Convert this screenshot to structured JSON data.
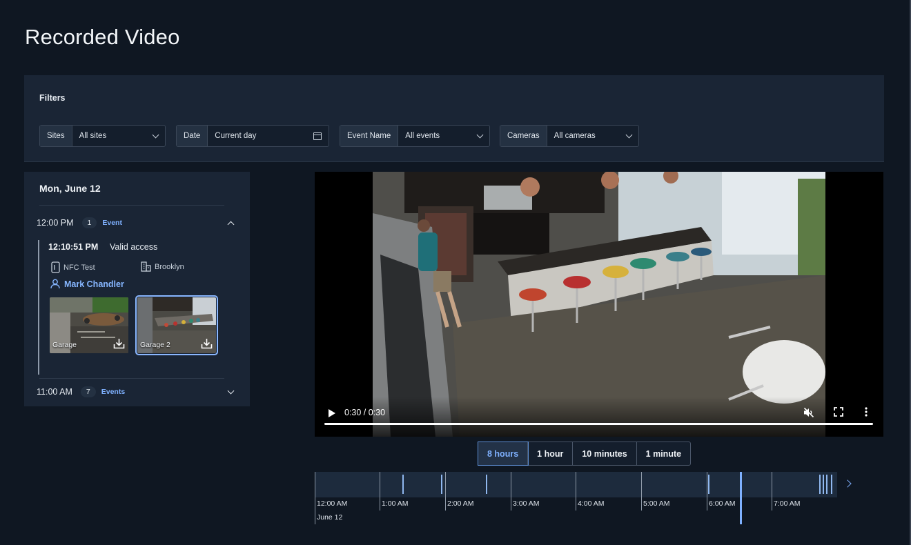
{
  "page": {
    "title": "Recorded Video"
  },
  "filters": {
    "title": "Filters",
    "sites": {
      "label": "Sites",
      "value": "All sites"
    },
    "date": {
      "label": "Date",
      "value": "Current day"
    },
    "event_name": {
      "label": "Event Name",
      "value": "All events"
    },
    "cameras": {
      "label": "Cameras",
      "value": "All cameras"
    }
  },
  "events_panel": {
    "day": "Mon, June 12",
    "groups": [
      {
        "time": "12:00 PM",
        "count": "1",
        "unit": "Event",
        "expanded": true
      },
      {
        "time": "11:00 AM",
        "count": "7",
        "unit": "Events",
        "expanded": false
      }
    ],
    "event": {
      "time": "12:10:51 PM",
      "name": "Valid access",
      "device": "NFC Test",
      "site": "Brooklyn",
      "person": "Mark Chandler",
      "cameras": [
        {
          "name": "Garage",
          "selected": false
        },
        {
          "name": "Garage 2",
          "selected": true
        }
      ]
    }
  },
  "player": {
    "time": "0:30 / 0:30",
    "progress": 1.0,
    "muted": true
  },
  "zoom": {
    "options": [
      "8 hours",
      "1 hour",
      "10 minutes",
      "1 minute"
    ],
    "active": "8 hours"
  },
  "timeline": {
    "labels": [
      "12:00 AM",
      "1:00 AM",
      "2:00 AM",
      "3:00 AM",
      "4:00 AM",
      "5:00 AM",
      "6:00 AM",
      "7:00 AM"
    ],
    "date": "June 12"
  },
  "colors": {
    "accent": "#7fb1ff",
    "panel": "#1a2535",
    "background": "#0f1722"
  }
}
